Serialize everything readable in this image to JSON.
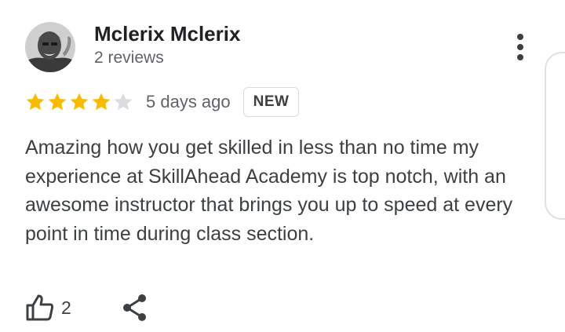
{
  "reviewer": {
    "name": "Mclerix Mclerix",
    "review_count": "2 reviews"
  },
  "review": {
    "rating": 4,
    "max_rating": 5,
    "date": "5 days ago",
    "badge": "NEW",
    "text": "Amazing how you get skilled in less than no time my experience at SkillAhead Academy is top notch, with an awesome instructor that brings you up to speed at every point in time during class section."
  },
  "actions": {
    "like_count": "2"
  },
  "colors": {
    "star_filled": "#F9BB02",
    "star_empty": "#DADCE0",
    "text_primary": "#202124",
    "text_secondary": "#5f6368"
  },
  "icons": {
    "more": "more-vert-icon",
    "like": "thumb-up-icon",
    "share": "share-icon"
  }
}
